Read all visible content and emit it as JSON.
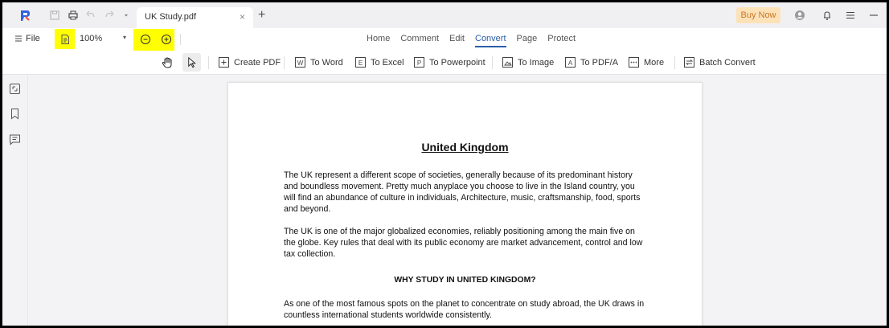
{
  "titlebar": {
    "tab_title": "UK Study.pdf",
    "tab_close": "×",
    "new_tab": "+",
    "buy_now": "Buy Now"
  },
  "toolbar": {
    "file_label": "File",
    "zoom_value": "100%",
    "zoom_caret": "▾",
    "highlight_color": "#ffff00"
  },
  "menu": {
    "tabs": [
      "Home",
      "Comment",
      "Edit",
      "Convert",
      "Page",
      "Protect"
    ],
    "active": "Convert"
  },
  "convert": {
    "create_pdf": "Create PDF",
    "to_word": "To Word",
    "to_excel": "To Excel",
    "to_powerpoint": "To Powerpoint",
    "to_image": "To Image",
    "to_pdfa": "To PDF/A",
    "more": "More",
    "batch_convert": "Batch Convert"
  },
  "document": {
    "title": "United Kingdom",
    "para1_lines": [
      "The UK represent a different scope of societies, generally because of its predominant history",
      "and boundless movement. Pretty much anyplace you choose to live in the Island country, you",
      "will find an abundance of culture in individuals, Architecture, music, craftsmanship, food, sports",
      "and beyond."
    ],
    "para2_lines": [
      "The UK is one of the major globalized economies, reliably positioning among the main five on",
      "the globe. Key rules that deal with its public economy are market advancement, control and low",
      "tax collection."
    ],
    "subheading": "WHY STUDY IN UNITED KINGDOM?",
    "para3_lines": [
      "As one of the most famous spots on the planet to concentrate on study abroad, the UK draws in",
      "countless international students worldwide consistently."
    ]
  },
  "colors": {
    "accent": "#2b5ea8",
    "buy_now_bg": "#fde2b8",
    "buy_now_text": "#c9772a"
  }
}
